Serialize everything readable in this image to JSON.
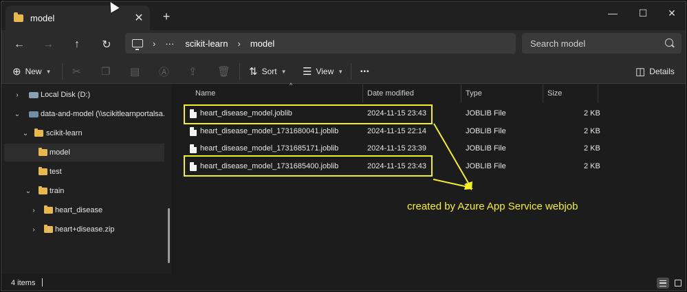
{
  "tab": {
    "title": "model",
    "close": "✕",
    "new": "+"
  },
  "window_controls": {
    "minimize": "—",
    "maximize": "☐",
    "close": "✕"
  },
  "nav": {
    "back": "←",
    "forward": "→",
    "up": "↑",
    "refresh": "↻"
  },
  "address": {
    "crumbs": [
      "scikit-learn",
      "model"
    ],
    "ellipsis": "···",
    "sep": "›"
  },
  "search": {
    "placeholder": "Search model"
  },
  "commands": {
    "new_label": "New",
    "sort_label": "Sort",
    "view_label": "View",
    "more": "•••",
    "details_label": "Details"
  },
  "sidebar": {
    "items": [
      {
        "label": "Local Disk (D:)",
        "chevron": "›",
        "icon": "drive-icon"
      },
      {
        "label": "data-and-model (\\\\scikitlearnportalsa.fi",
        "chevron": "⌄",
        "icon": "network-drive-icon"
      },
      {
        "label": "scikit-learn",
        "chevron": "⌄",
        "icon": "folder-icon"
      },
      {
        "label": "model",
        "chevron": "",
        "icon": "folder-icon"
      },
      {
        "label": "test",
        "chevron": "",
        "icon": "folder-icon"
      },
      {
        "label": "train",
        "chevron": "⌄",
        "icon": "folder-icon"
      },
      {
        "label": "heart_disease",
        "chevron": "›",
        "icon": "folder-icon"
      },
      {
        "label": "heart+disease.zip",
        "chevron": "›",
        "icon": "zip-folder-icon"
      }
    ]
  },
  "columns": {
    "name": "Name",
    "date": "Date modified",
    "type": "Type",
    "size": "Size",
    "sort_arrow": "^"
  },
  "files": [
    {
      "name": "heart_disease_model.joblib",
      "date": "2024-11-15 23:43",
      "type": "JOBLIB File",
      "size": "2 KB"
    },
    {
      "name": "heart_disease_model_1731680041.joblib",
      "date": "2024-11-15 22:14",
      "type": "JOBLIB File",
      "size": "2 KB"
    },
    {
      "name": "heart_disease_model_1731685171.joblib",
      "date": "2024-11-15 23:39",
      "type": "JOBLIB File",
      "size": "2 KB"
    },
    {
      "name": "heart_disease_model_1731685400.joblib",
      "date": "2024-11-15 23:43",
      "type": "JOBLIB File",
      "size": "2 KB"
    }
  ],
  "annotation": {
    "text": "created by Azure App Service webjob",
    "color": "#f5f020"
  },
  "status": {
    "items": "4 items"
  },
  "colors": {
    "folder": "#e8b84a",
    "background": "#1c1c1c",
    "highlight": "#f5f020"
  }
}
